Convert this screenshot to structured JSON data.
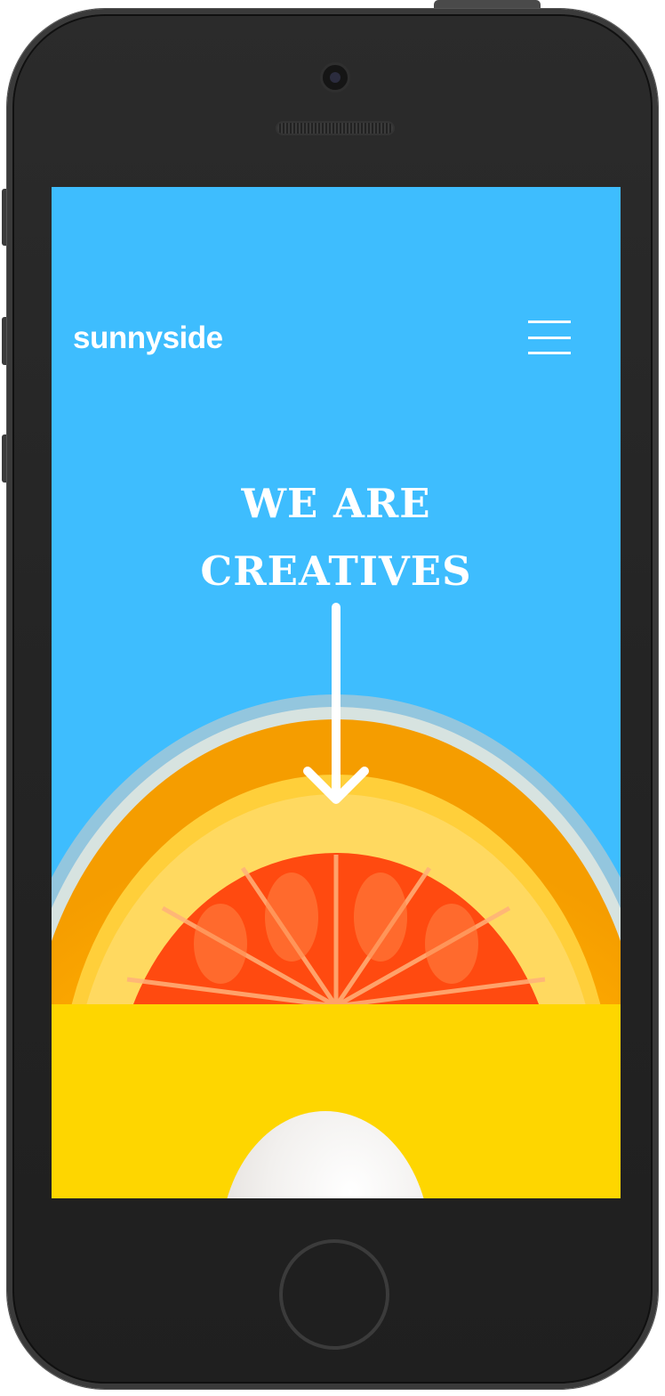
{
  "device": {
    "name": "smartphone-frame"
  },
  "header": {
    "logo": "sunnyside",
    "menu_icon": "hamburger-menu-icon"
  },
  "hero": {
    "headline_line1": "WE ARE",
    "headline_line2": "CREATIVES",
    "scroll_icon": "arrow-down-icon",
    "background_color": "#3ebdfe",
    "image": "orange-slice-in-glass"
  },
  "next_section": {
    "background_color": "#fed600",
    "image": "white-egg"
  },
  "colors": {
    "text": "#ffffff",
    "sky_blue": "#3ebdfe",
    "yellow": "#fed600",
    "orange": "#ff5a1f"
  }
}
